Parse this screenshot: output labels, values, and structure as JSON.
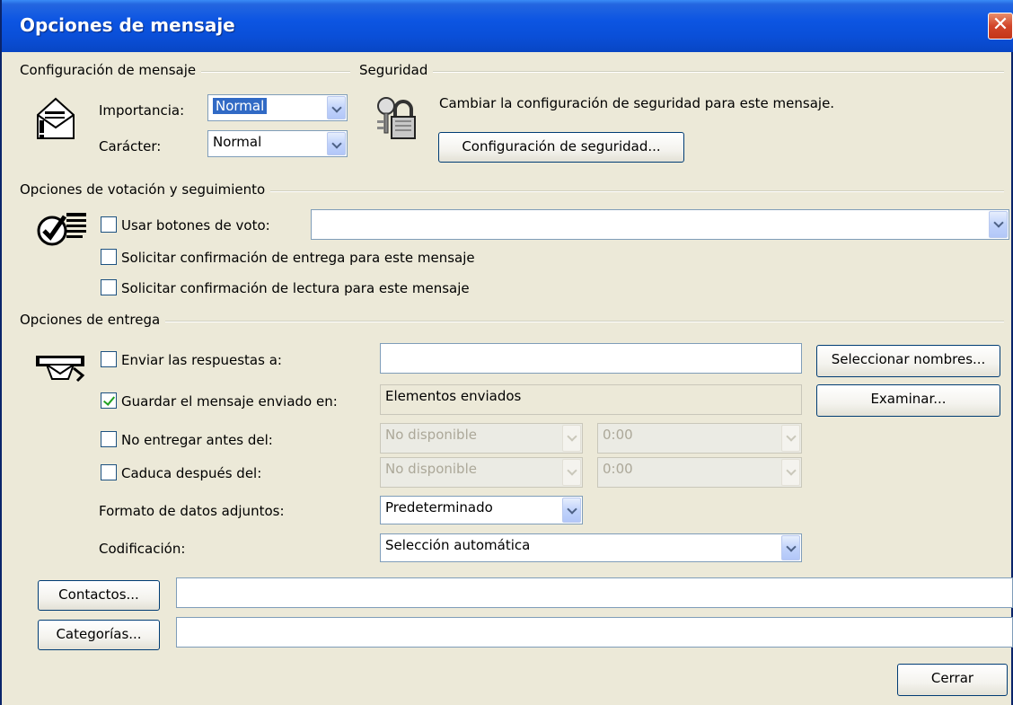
{
  "window": {
    "title": "Opciones de mensaje",
    "close_label": "✕"
  },
  "config_group": {
    "title": "Configuración de mensaje",
    "importance_label": "Importancia:",
    "importance_value": "Normal",
    "sensitivity_label": "Carácter:",
    "sensitivity_value": "Normal"
  },
  "security_group": {
    "title": "Seguridad",
    "description": "Cambiar la configuración de seguridad para este mensaje.",
    "button_label": "Configuración de seguridad..."
  },
  "voting_group": {
    "title": "Opciones de votación y seguimiento",
    "use_voting_label": "Usar botones de voto:",
    "use_voting_checked": false,
    "voting_value": "",
    "delivery_receipt_label": "Solicitar confirmación de entrega para este mensaje",
    "delivery_receipt_checked": false,
    "read_receipt_label": "Solicitar confirmación de lectura para este mensaje",
    "read_receipt_checked": false
  },
  "delivery_group": {
    "title": "Opciones de entrega",
    "replies_label": "Enviar las respuestas a:",
    "replies_checked": false,
    "replies_value": "",
    "select_names_label": "Seleccionar nombres...",
    "save_sent_label": "Guardar el mensaje enviado en:",
    "save_sent_checked": true,
    "save_sent_value": "Elementos enviados",
    "browse_label": "Examinar...",
    "no_deliver_label": "No entregar antes del:",
    "no_deliver_checked": false,
    "no_deliver_date": "No disponible",
    "no_deliver_time": "0:00",
    "expires_label": "Caduca después del:",
    "expires_checked": false,
    "expires_date": "No disponible",
    "expires_time": "0:00",
    "attachment_format_label": "Formato de datos adjuntos:",
    "attachment_format_value": "Predeterminado",
    "encoding_label": "Codificación:",
    "encoding_value": "Selección automática"
  },
  "contacts": {
    "button_label": "Contactos...",
    "value": ""
  },
  "categories": {
    "button_label": "Categorías...",
    "value": ""
  },
  "footer": {
    "close_label": "Cerrar"
  },
  "icons": [
    "envelope-importance-icon",
    "security-keys-lock-icon",
    "voting-check-icon",
    "delivery-hand-envelope-icon",
    "close-icon",
    "chevron-down-icon"
  ]
}
